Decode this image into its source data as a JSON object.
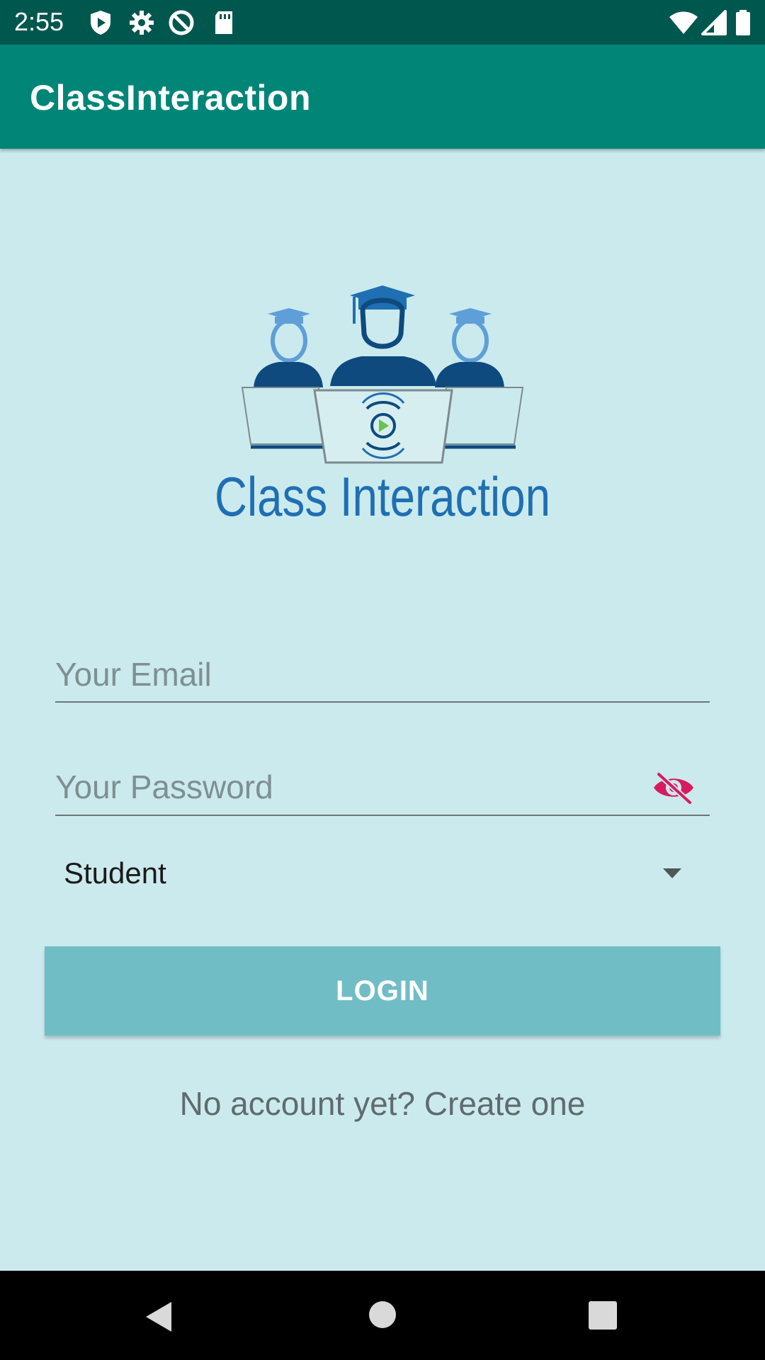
{
  "status_bar": {
    "time": "2:55",
    "left_icons": [
      "play-protect-icon",
      "settings-gear-icon",
      "vpn-icon",
      "sd-card-icon"
    ],
    "right_icons": [
      "wifi-icon",
      "cellular-signal-icon",
      "battery-icon"
    ]
  },
  "app_bar": {
    "title": "ClassInteraction"
  },
  "logo": {
    "text": "Class Interaction",
    "colors": {
      "dark_blue": "#0e4a7e",
      "mid_blue": "#1f6fb2",
      "light_blue": "#5f9fd8",
      "play_green": "#6cc24a"
    }
  },
  "form": {
    "email_placeholder": "Your Email",
    "password_placeholder": "Your Password",
    "password_toggle_icon": "eye-off-icon",
    "role_selected": "Student",
    "login_label": "LOGIN",
    "signup_text": "No account yet? Create one"
  },
  "nav_bar": {
    "items": [
      "back-icon",
      "home-icon",
      "recents-icon"
    ]
  },
  "colors": {
    "status_bar": "#00574e",
    "app_bar": "#008577",
    "background": "#cbeaed",
    "login_button": "#71bdc5",
    "eye_icon": "#d81b60"
  }
}
